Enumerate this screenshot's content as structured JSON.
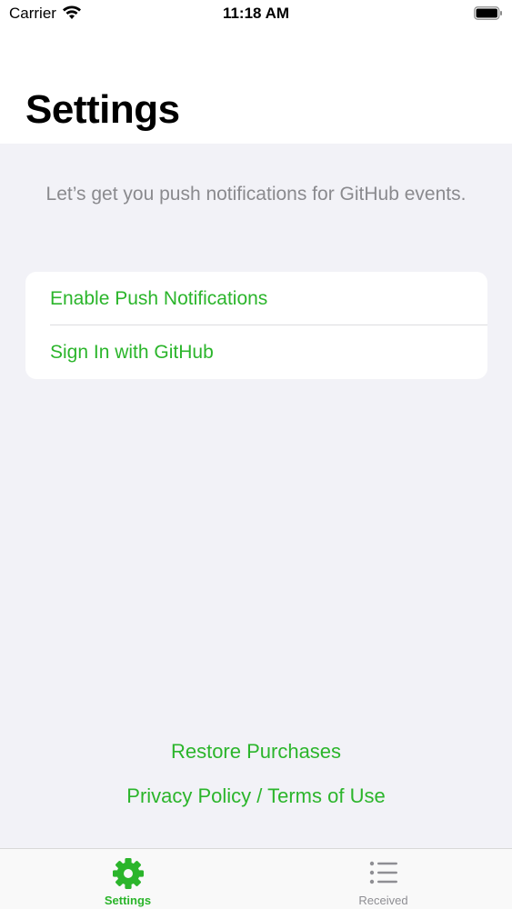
{
  "status_bar": {
    "carrier": "Carrier",
    "time": "11:18 AM"
  },
  "header": {
    "title": "Settings"
  },
  "intro": "Let’s get you push notifications for GitHub events.",
  "actions": {
    "enable_push": "Enable Push Notifications",
    "sign_in": "Sign In with GitHub"
  },
  "footer": {
    "restore": "Restore Purchases",
    "privacy": "Privacy Policy / Terms of Use"
  },
  "tabs": [
    {
      "label": "Settings",
      "icon": "gear-icon",
      "selected": true
    },
    {
      "label": "Received",
      "icon": "list-icon",
      "selected": false
    }
  ],
  "colors": {
    "accent": "#2bb52b",
    "muted": "#8e8e93",
    "background": "#f2f2f7"
  }
}
